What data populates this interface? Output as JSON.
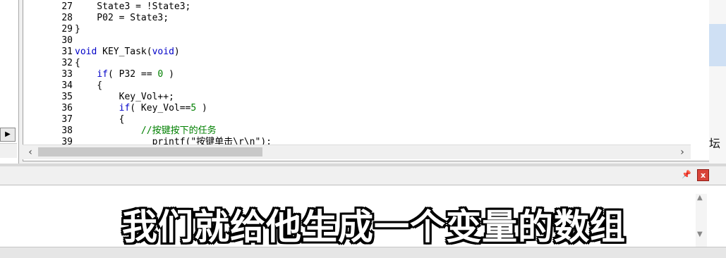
{
  "code_lines": [
    {
      "num": "27",
      "text": "    State3 = !State3;"
    },
    {
      "num": "28",
      "text": "    P02 = State3;"
    },
    {
      "num": "29",
      "text": "}"
    },
    {
      "num": "30",
      "text": ""
    },
    {
      "num": "31",
      "pre": "",
      "kw": "void",
      "post": " KEY_Task(",
      "kw2": "void",
      "post2": ")"
    },
    {
      "num": "32",
      "text": "{"
    },
    {
      "num": "33",
      "pre": "    ",
      "kw": "if",
      "post": "( P32 == ",
      "n": "0",
      "post2": " )"
    },
    {
      "num": "34",
      "text": "    {"
    },
    {
      "num": "35",
      "text": "        Key_Vol++;"
    },
    {
      "num": "36",
      "pre": "        ",
      "kw": "if",
      "post": "( Key_Vol==",
      "n": "5",
      "post2": " )"
    },
    {
      "num": "37",
      "text": "        {"
    },
    {
      "num": "38",
      "cmt": "            //按键按下的任务"
    }
  ],
  "partial_line": {
    "num": "39",
    "text": "              printf(\"按键单击\\r\\n\");"
  },
  "panel": {
    "pin_icon": "pin-icon",
    "close_label": "x"
  },
  "right_strip_text": "坛",
  "subtitle": "我们就给他生成一个变量的数组",
  "colors": {
    "keyword": "#0000c8",
    "number": "#008000",
    "comment": "#008000",
    "close": "#d9443a"
  }
}
